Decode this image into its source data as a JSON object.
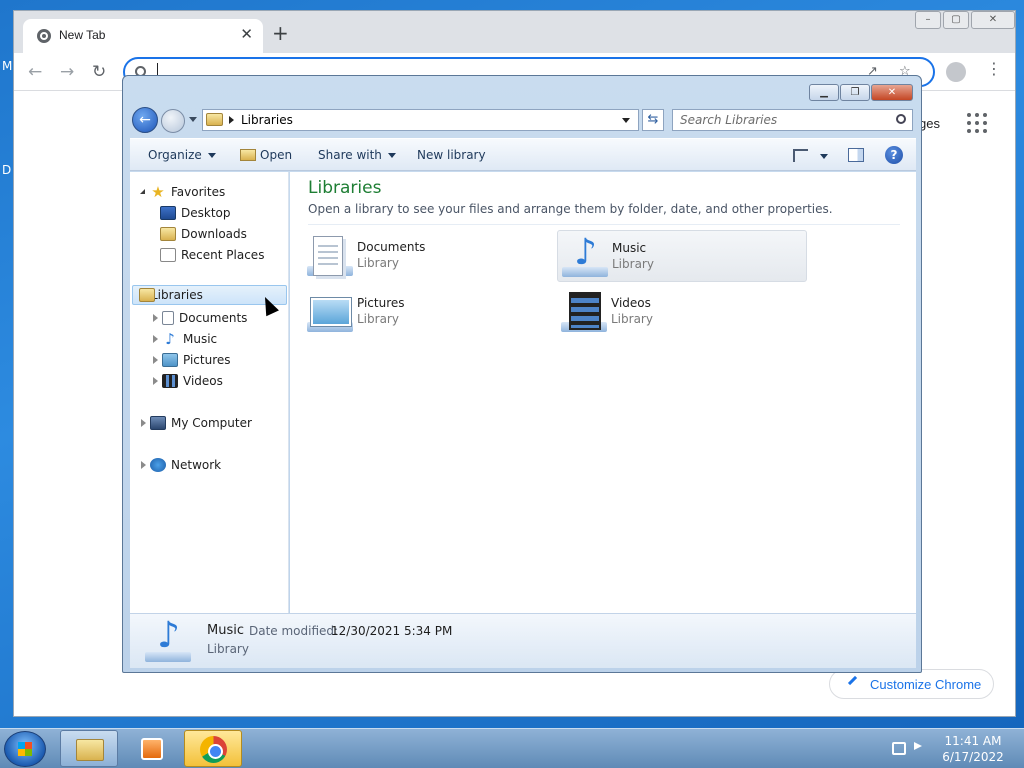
{
  "desktop": {
    "frag1": "M",
    "frag2": "D"
  },
  "chrome": {
    "tab_title": "New Tab",
    "tab_close": "✕",
    "new_tab": "+",
    "win_min": "–",
    "win_max": "▢",
    "win_close": "✕",
    "back": "←",
    "forward": "→",
    "reload": "↻",
    "share_icon": "↗",
    "star_icon": "☆",
    "menu_icon": "⋮",
    "apps_partial": "ges",
    "customize": "Customize Chrome"
  },
  "explorer": {
    "btn_min": "▁",
    "btn_max": "❐",
    "btn_close": "✕",
    "back": "←",
    "refresh": "⇆",
    "address": "Libraries",
    "search_placeholder": "Search Libraries",
    "toolbar": {
      "organize": "Organize",
      "open": "Open",
      "share": "Share with",
      "new_library": "New library",
      "help": "?"
    },
    "nav": {
      "favorites": "Favorites",
      "desktop": "Desktop",
      "downloads": "Downloads",
      "recent": "Recent Places",
      "libraries": "Libraries",
      "documents": "Documents",
      "music": "Music",
      "pictures": "Pictures",
      "videos": "Videos",
      "computer": "My Computer",
      "network": "Network"
    },
    "content": {
      "title": "Libraries",
      "subtitle": "Open a library to see your files and arrange them by folder, date, and other properties.",
      "items": [
        {
          "name": "Documents",
          "type": "Library"
        },
        {
          "name": "Music",
          "type": "Library"
        },
        {
          "name": "Pictures",
          "type": "Library"
        },
        {
          "name": "Videos",
          "type": "Library"
        }
      ]
    },
    "details": {
      "name": "Music",
      "modified_label": "Date modified:",
      "modified_value": "12/30/2021 5:34 PM",
      "type": "Library"
    }
  },
  "taskbar": {
    "time": "11:41 AM",
    "date": "6/17/2022"
  },
  "colors": {
    "accent": "#1a73e8",
    "explorer_title": "#1e7e34"
  }
}
